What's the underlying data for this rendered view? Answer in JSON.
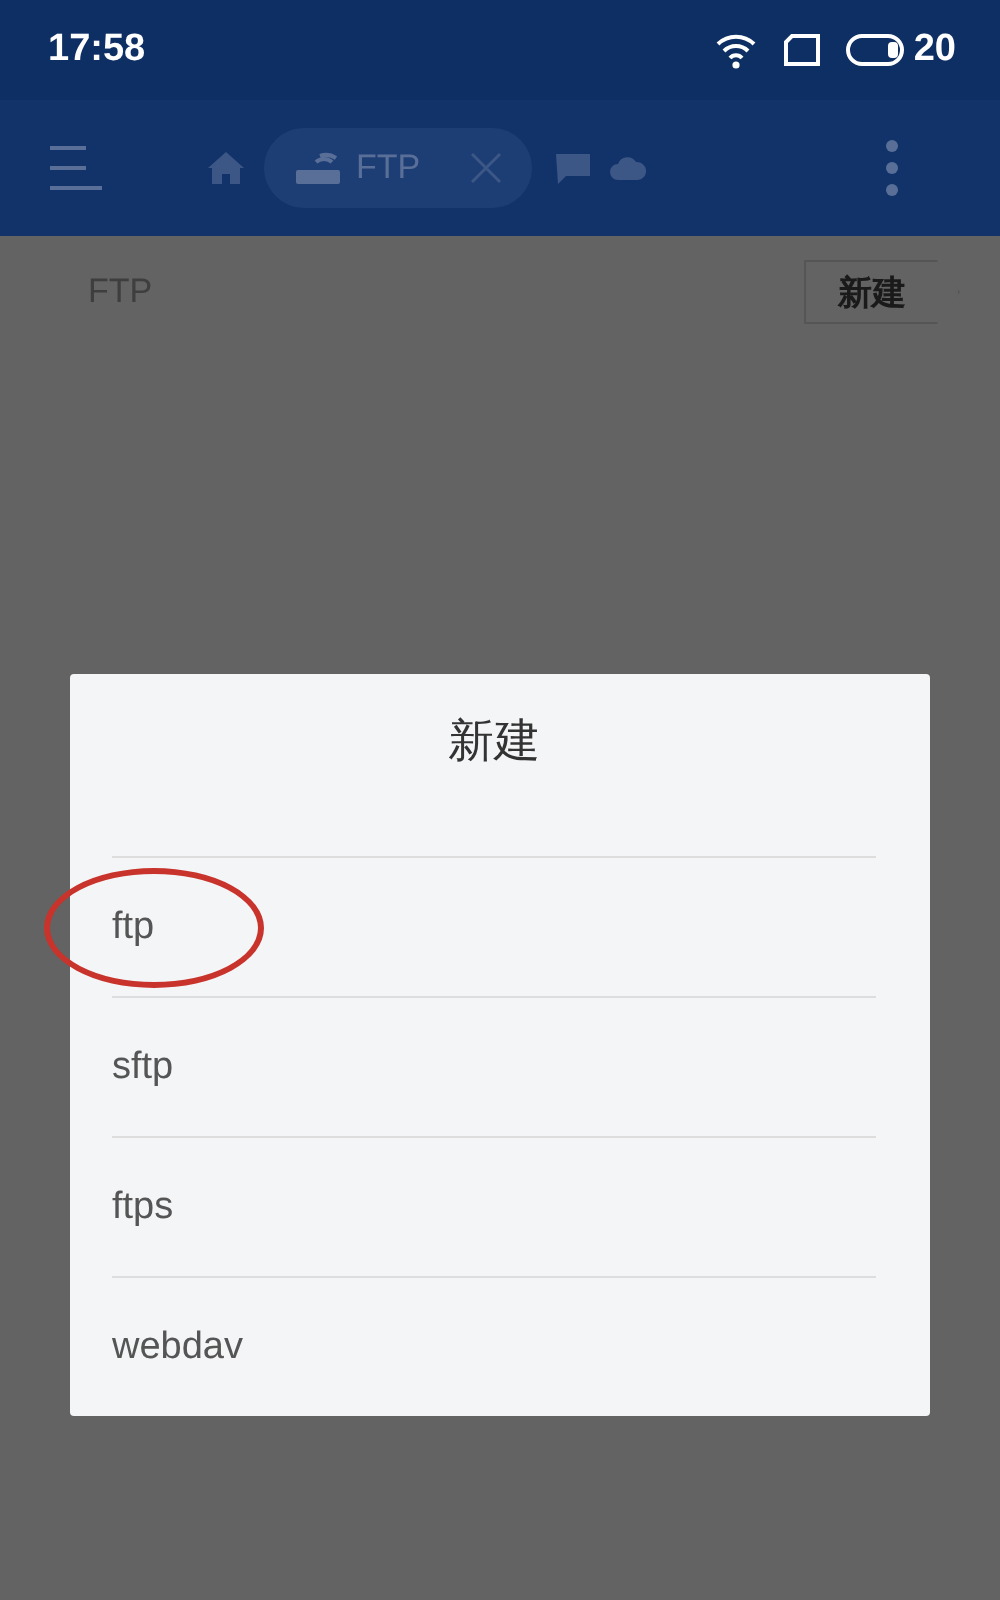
{
  "status_bar": {
    "time": "17:58",
    "battery": "20"
  },
  "toolbar": {
    "tab": {
      "label": "FTP",
      "selected": true
    }
  },
  "breadcrumb": {
    "path": "FTP",
    "new_button": "新建"
  },
  "dialog": {
    "title": "新建",
    "items": [
      {
        "label": "ftp",
        "circled": true
      },
      {
        "label": "sftp",
        "circled": false
      },
      {
        "label": "ftps",
        "circled": false
      },
      {
        "label": "webdav",
        "circled": false
      }
    ]
  }
}
